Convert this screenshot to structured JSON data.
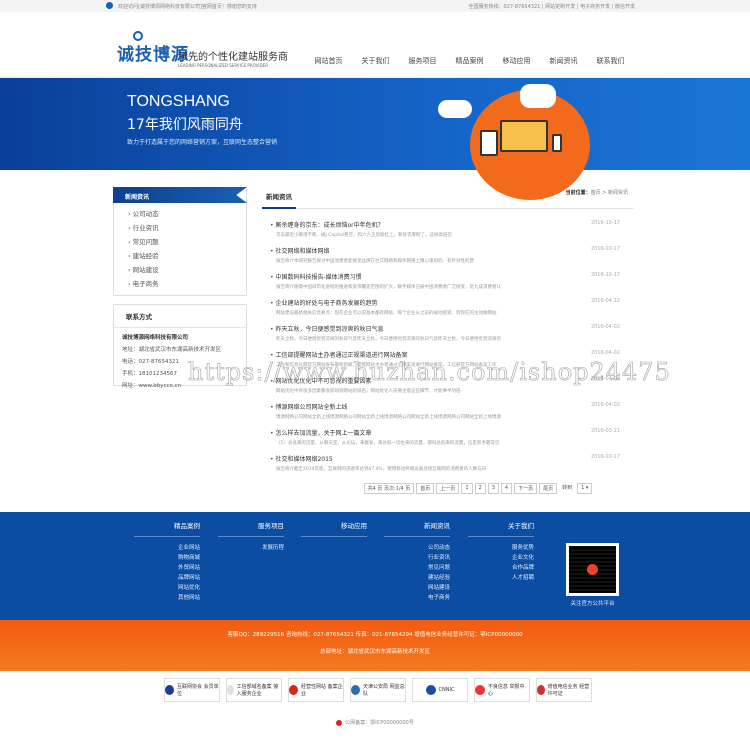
{
  "topbar": {
    "welcome": "欢迎访问[诚技博源网络科技有限公司]官网首页！感谢您的支持",
    "hotline": "全国服务热线：027-87654321",
    "links": [
      "网站定制开发",
      "电子商务开发",
      "微信开发"
    ]
  },
  "header": {
    "logo": "诚技博源",
    "slogan": "领先的个性化建站服务商",
    "slogan_en": "LEADING PERSONALIZED SERVICE PROVIDER",
    "nav": [
      "网站首页",
      "关于我们",
      "服务项目",
      "精品案例",
      "移动应用",
      "新闻资讯",
      "联系我们"
    ]
  },
  "banner": {
    "title": "TONGSHANG",
    "subtitle": "17年我们风雨同舟",
    "desc": "致力于打造属于您的网络营销方案，互联网生态整合营销"
  },
  "sidebar": {
    "title": "新闻资讯",
    "items": [
      "公司动态",
      "行业资讯",
      "常见问题",
      "建站经验",
      "网站建设",
      "电子商务"
    ]
  },
  "contact": {
    "title": "联系方式",
    "company": "诚技博源网络科技有限公司",
    "address": "地址：湖北省武汉市东湖高新技术开发区",
    "phone": "电话：027-87654321",
    "mobile": "手机：18101234567",
    "site": "网址：www.bbycco.cn"
  },
  "main": {
    "tab": "新闻资讯",
    "crumb_label": "当前位置：",
    "crumb": "首页 > 新闻资讯",
    "news": [
      {
        "title": "厮杀缠身的京东：成长烦恼or中年危机？",
        "desc": "京东最近小麻烦不断，被J Capital看空，和六六王思聪杠上，和优衣库掰了，这样高层在",
        "date": "2016-10-17"
      },
      {
        "title": "社交网络和媒体网络",
        "desc": "报告简介本研究报告探讨中国消费者能接受品牌在社交网络和媒体网络上精心策划的、有针对性的营",
        "date": "2016-10-17"
      },
      {
        "title": "中国数码科技报告-媒体消费习惯",
        "desc": "报告简介随着中国城市化进程的推进和宽带覆盖范围的扩大，数字媒体已被中国消费者广泛接受，近九成消费者认",
        "date": "2016-10-17"
      },
      {
        "title": "企业建站的好处与电子商务发展的趋势",
        "desc": "网站建设最新相关信息要点：现在企业可以说基本都有网站，每个企业从之前的被动接受，到现在的主动做网站",
        "date": "2016-04-12"
      },
      {
        "title": "昨天立秋，今日便感觉到凉爽的秋日气息",
        "desc": "昨天立秋，今日便感觉到凉爽的秋日气息昨天立秋，今日便感觉到凉爽的秋日气息昨天立秋，今日便感觉到凉爽的",
        "date": "2016-04-02"
      },
      {
        "title": "工信部提醒网站主办者通过正规渠道进行网站备案",
        "desc": "工业和信息化部官方网站发布最新新闻，提醒网站主办者通过正规渠道进行网站备案，工信部官方网站备案工作",
        "date": "2016-04-02"
      },
      {
        "title": "网站优化优化中不可忽视的重要因素",
        "desc": "网站优化中有很多因素都会影响到网站的排名，网站优化人员要注意这些细节，才能事半功倍",
        "date": "2016-04-02"
      },
      {
        "title": "博源网络公司网站全新上线",
        "desc": "博源网络公司网站全新上线博源网络公司网站全新上线博源网络公司网站全新上线博源网络公司网站全新上线博源",
        "date": "2016-04-02"
      },
      {
        "title": "怎么样去加流量，关于网上一篇文章",
        "desc": "（1）总低来的流量，从聊天室，从论坛，来群发，来总低一切拉来的流量，都叫总低来的流量，这是新手最常见",
        "date": "2016-03-21"
      },
      {
        "title": "社交和媒体网络2015",
        "desc": "报告简介截至2014年底，互联网的渗透率达到47.4%，使用移动终端设备连接互联网的消费者的人数与日",
        "date": "2016-10-17"
      }
    ],
    "pager": {
      "total": "共4 页 页次:1/4 页",
      "first": "首页",
      "prev": "上一页",
      "pages": [
        "1",
        "2",
        "3",
        "4"
      ],
      "next": "下一页",
      "last": "尾页",
      "jump": "转到",
      "select": "1"
    }
  },
  "watermark": "https://www.huzhan.com/ishop24475",
  "footer": {
    "cols": [
      {
        "title": "精品案例",
        "links": [
          "企业网站",
          "购物商城",
          "外贸网站",
          "品牌网站",
          "网站优化",
          "其他网站"
        ]
      },
      {
        "title": "服务项目",
        "links": [
          "发展历程"
        ]
      },
      {
        "title": "移动应用",
        "links": []
      },
      {
        "title": "新闻资讯",
        "links": [
          "公司动态",
          "行业资讯",
          "常见问题",
          "建站经验",
          "网站建设",
          "电子商务"
        ]
      },
      {
        "title": "关于我们",
        "links": [
          "服务优势",
          "企业文化",
          "合作品牌",
          "人才招聘"
        ]
      }
    ],
    "qr_caption": "关注官方公共平台",
    "contact_line": "客服QQ：289229516  咨询热线：027-87654321  传真：021-87654294  增值电信业务经营许可证：鄂ICP00000000",
    "address_line": "总部地址：湖北省武汉市东湖高新技术开发区",
    "badges": [
      "互联网协会 会员单位",
      "工信部域名备案 接入服务企业",
      "经营性网站 备案企业",
      "天津公安局 网监总队",
      "CNNIC",
      "不良信息 举报中心",
      "增值电信业务 经营许可证"
    ],
    "icp": "公网备案：鄂ICP00000000号"
  },
  "colors": {
    "primary": "#0b4da3",
    "orange": "#f25a10"
  }
}
